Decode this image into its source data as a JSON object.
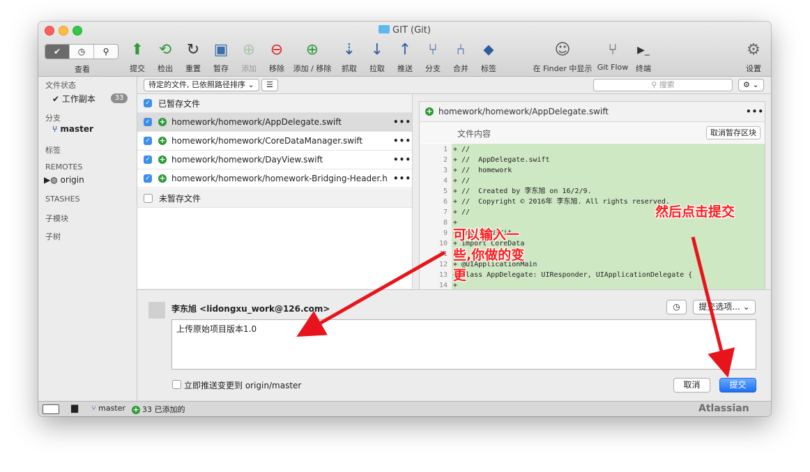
{
  "window": {
    "title": "GIT (Git)"
  },
  "toolbar": {
    "view_label": "查看",
    "items": [
      {
        "label": "提交",
        "icon": "commit-icon"
      },
      {
        "label": "检出",
        "icon": "checkout-icon"
      },
      {
        "label": "重置",
        "icon": "reset-icon"
      },
      {
        "label": "暂存",
        "icon": "stash-icon"
      },
      {
        "label": "添加",
        "icon": "add-icon"
      },
      {
        "label": "移除",
        "icon": "remove-icon"
      },
      {
        "label": "添加 / 移除",
        "icon": "add-remove-icon"
      },
      {
        "label": "抓取",
        "icon": "fetch-icon"
      },
      {
        "label": "拉取",
        "icon": "pull-icon"
      },
      {
        "label": "推送",
        "icon": "push-icon"
      },
      {
        "label": "分支",
        "icon": "branch-icon"
      },
      {
        "label": "合并",
        "icon": "merge-icon"
      },
      {
        "label": "标签",
        "icon": "tag-icon"
      },
      {
        "label": "在 Finder 中显示",
        "icon": "finder-icon"
      },
      {
        "label": "Git Flow",
        "icon": "git-flow-icon"
      },
      {
        "label": "终端",
        "icon": "terminal-icon"
      },
      {
        "label": "设置",
        "icon": "settings-icon"
      }
    ]
  },
  "sidebar": {
    "file_status": "文件状态",
    "working_copy": "工作副本",
    "working_copy_count": "33",
    "branches": "分支",
    "branch": "master",
    "tags": "标签",
    "remotes": "REMOTES",
    "remote": "origin",
    "stashes": "STASHES",
    "submodules": "子模块",
    "subtrees": "子树"
  },
  "filelist": {
    "sort_option": "待定的文件, 已依照路径排序",
    "search_placeholder": "搜索",
    "staged_header": "已暂存文件",
    "unstaged_header": "未暂存文件",
    "files": [
      "homework/homework/AppDelegate.swift",
      "homework/homework/CoreDataManager.swift",
      "homework/homework/DayView.swift",
      "homework/homework/homework-Bridging-Header.h"
    ]
  },
  "diff": {
    "file": "homework/homework/AppDelegate.swift",
    "section": "文件内容",
    "unstage_label": "取消暂存区块",
    "lines": [
      {
        "n": "1",
        "t": "+ //"
      },
      {
        "n": "2",
        "t": "+ //  AppDelegate.swift"
      },
      {
        "n": "3",
        "t": "+ //  homework"
      },
      {
        "n": "4",
        "t": "+ //"
      },
      {
        "n": "5",
        "t": "+ //  Created by 李东旭 on 16/2/9."
      },
      {
        "n": "6",
        "t": "+ //  Copyright © 2016年 李东旭. All rights reserved."
      },
      {
        "n": "7",
        "t": "+ //"
      },
      {
        "n": "8",
        "t": "+"
      },
      {
        "n": "9",
        "t": "+ import UIKit"
      },
      {
        "n": "10",
        "t": "+ import CoreData"
      },
      {
        "n": "11",
        "t": "+"
      },
      {
        "n": "12",
        "t": "+ @UIApplicationMain"
      },
      {
        "n": "13",
        "t": "+ class AppDelegate: UIResponder, UIApplicationDelegate {"
      },
      {
        "n": "14",
        "t": "+"
      }
    ]
  },
  "commit": {
    "author": "李东旭 <lidongxu_work@126.com>",
    "message": "上传原始项目版本1.0",
    "options_label": "提交选项...",
    "push_label": "立即推送变更到 origin/master",
    "cancel_label": "取消",
    "commit_label": "提交"
  },
  "statusbar": {
    "branch": "master",
    "added": "33 已添加的",
    "brand": "Atlassian"
  },
  "annotations": {
    "input_hint": [
      "可以输入一",
      "些,你做的变",
      "更"
    ],
    "commit_hint": "然后点击提交"
  }
}
